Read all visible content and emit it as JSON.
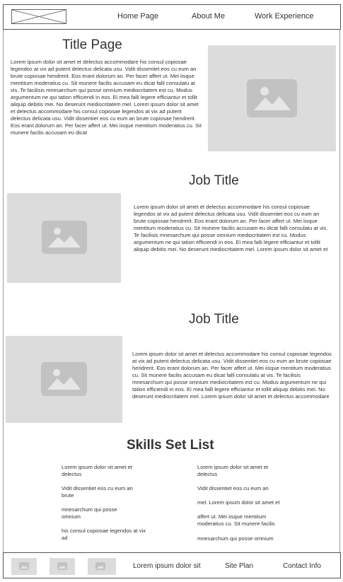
{
  "nav": {
    "home": "Home Page",
    "about": "About Me",
    "work": "Work Experience"
  },
  "intro": {
    "title": "Title Page",
    "body": "Lorem ipsum dolor sit amet et delectus accommodare his consul copiosae legendos at vix ad putent delectus delicata usu. Vidit dissentiet eos cu eum an brute copiosae hendrerit. Eos erant dolorum an. Per facer affert ut. Mei iisque mentitum moderatius cu. Sit munere facilis accusam eu dicat falli consulatu at vis. Te facilisis mnesarchum qui posse omnium mediocritatem est cu. Modus argumentum ne qui tation efficiendi in eos. Ei mea falli legere efficiantur et tollit aliquip debitis mei. No deserunt mediocritatem mel. Lorem ipsum dolor sit amet et delectus accommodare his consul copiosae legendos at vix ad putent delectus delicata usu. Vidit dissentiet eos cu eum an brute copiosae hendrerit. Eos erant dolorum an. Per facer affert ut. Mei iisque mentitum moderatius cu. Sit munere facilis accusam eu dicat"
  },
  "jobs": [
    {
      "title": "Job Title",
      "body": "Lorem ipsum dolor sit amet et delectus accommodare his consul copiosae legendos at vix ad putent delectus delicata usu. Vidit dissentiet eos cu eum an brute copiosae hendrerit. Eos erant dolorum an. Per facer affert ut. Mei iisque mentitum moderatius cu. Sit munere facilis accusam eu dicat falli consulatu at vis. Te facilisis mnesarchum qui posse omnium mediocritatem est cu. Modus argumentum ne qui tation efficiendi in eos. Ei mea falli legere efficiantur et tollit aliquip debitis mei. No deserunt mediocritatem mel. Lorem ipsum dolor sit amet et"
    },
    {
      "title": "Job Title",
      "body": "Lorem ipsum dolor sit amet et delectus accommodare his consul copiosae legendos at vix ad putent delectus delicata usu. Vidit dissentiet eos cu eum an brute copiosae hendrerit. Eos erant dolorum an. Per facer affert ut. Mei iisque mentitum moderatius cu. Sit munere facilis accusam eu dicat falli consulatu at vis. Te facilisis mnesarchum qui posse omnium mediocritatem est cu. Modus argumentum ne qui tation efficiendi in eos. Ei mea falli legere efficiantur et tollit aliquip debitis mei. No deserunt mediocritatem mel. Lorem ipsum dolor sit amet et delectus accommodare"
    }
  ],
  "skills": {
    "title": "Skills Set List",
    "left": [
      "Lorem ipsum dolor sit amet et delectus",
      "Vidit dissentiet eos cu eum an brute",
      "mnesarchum qui posse omnium",
      "his consul copiosae legendos at vix ad"
    ],
    "right": [
      "Lorem ipsum dolor sit amet et delectus",
      "Vidit dissentiet eos cu eum an",
      "mel. Lorem ipsum dolor sit amet et",
      "affert ut. Mei iisque mentitum moderatius cu. Sit munere facilis",
      "mnesarchum qui posse omnium"
    ]
  },
  "footer": {
    "text": "Lorem ipsum dolor sit",
    "site_plan": "Site Plan",
    "contact": "Contact Info"
  },
  "colors": {
    "placeholder_bg": "#dcdcdc",
    "placeholder_glyph": "#c2c2c2",
    "border": "#555555"
  },
  "icons": {
    "logo": "logo-placeholder-icon",
    "image": "image-placeholder-icon"
  }
}
